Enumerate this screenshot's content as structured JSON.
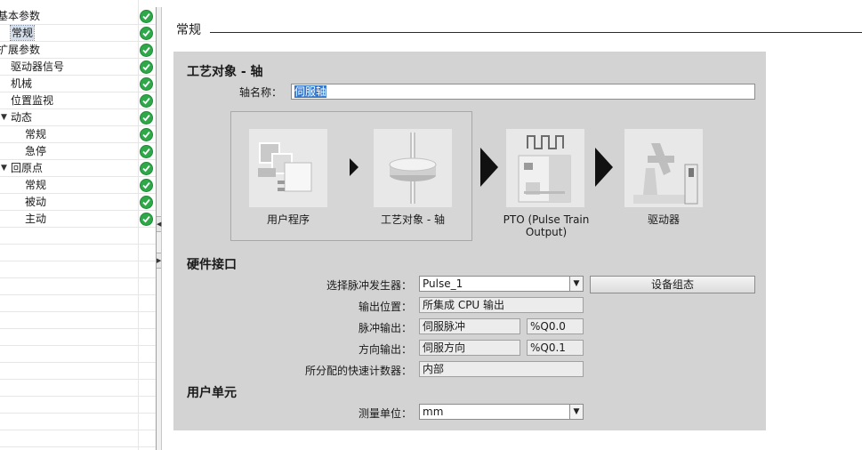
{
  "tree": {
    "items": [
      {
        "label": "基本参数",
        "indent": 0,
        "arrow": ""
      },
      {
        "label": "常规",
        "indent": 1,
        "arrow": "",
        "selected": true
      },
      {
        "label": "扩展参数",
        "indent": 0,
        "arrow": ""
      },
      {
        "label": "驱动器信号",
        "indent": 1,
        "arrow": ""
      },
      {
        "label": "机械",
        "indent": 1,
        "arrow": ""
      },
      {
        "label": "位置监视",
        "indent": 1,
        "arrow": ""
      },
      {
        "label": "动态",
        "indent": 1,
        "arrow": "▼"
      },
      {
        "label": "常规",
        "indent": 2,
        "arrow": ""
      },
      {
        "label": "急停",
        "indent": 2,
        "arrow": ""
      },
      {
        "label": "回原点",
        "indent": 1,
        "arrow": "▼"
      },
      {
        "label": "常规",
        "indent": 2,
        "arrow": ""
      },
      {
        "label": "被动",
        "indent": 2,
        "arrow": ""
      },
      {
        "label": "主动",
        "indent": 2,
        "arrow": ""
      }
    ]
  },
  "section": {
    "title": "常规"
  },
  "tech_object": {
    "title": "工艺对象 - 轴",
    "axis_name_label": "轴名称：",
    "axis_name_value": "伺服轴"
  },
  "diagram": {
    "user_program": "用户程序",
    "tech_object_axis": "工艺对象 - 轴",
    "pto_line1": "PTO (Pulse Train",
    "pto_line2": "Output)",
    "drive": "驱动器"
  },
  "hardware": {
    "title": "硬件接口",
    "pulse_gen_label": "选择脉冲发生器：",
    "pulse_gen_value": "Pulse_1",
    "device_config_button": "设备组态",
    "output_location_label": "输出位置：",
    "output_location_value": "所集成 CPU 输出",
    "pulse_output_label": "脉冲输出：",
    "pulse_output_value": "伺服脉冲",
    "pulse_output_addr": "%Q0.0",
    "direction_output_label": "方向输出：",
    "direction_output_value": "伺服方向",
    "direction_output_addr": "%Q0.1",
    "hsc_label": "所分配的快速计数器：",
    "hsc_value": "内部"
  },
  "user_unit": {
    "title": "用户单元",
    "unit_label": "测量单位：",
    "unit_value": "mm"
  },
  "colors": {
    "check": "#2fa84a",
    "panel": "#d3d3d3",
    "selection": "#3a78c8"
  }
}
